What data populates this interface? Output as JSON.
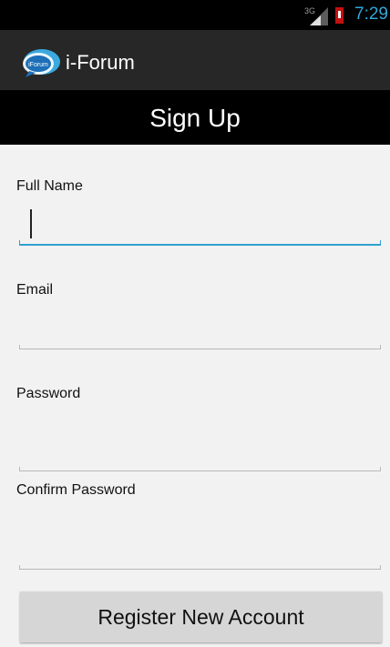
{
  "status_bar": {
    "network_label": "3G",
    "time": "7:29"
  },
  "app_bar": {
    "icon_text": "iForum",
    "title": "i-Forum"
  },
  "screen": {
    "title": "Sign Up"
  },
  "form": {
    "full_name": {
      "label": "Full Name",
      "value": ""
    },
    "email": {
      "label": "Email",
      "value": ""
    },
    "password": {
      "label": "Password",
      "value": ""
    },
    "confirm_password": {
      "label": "Confirm Password",
      "value": ""
    }
  },
  "register_button": {
    "label": "Register New Account"
  },
  "colors": {
    "accent": "#2fa0d0",
    "status_time": "#2fa8dc",
    "battery": "#c01010"
  }
}
